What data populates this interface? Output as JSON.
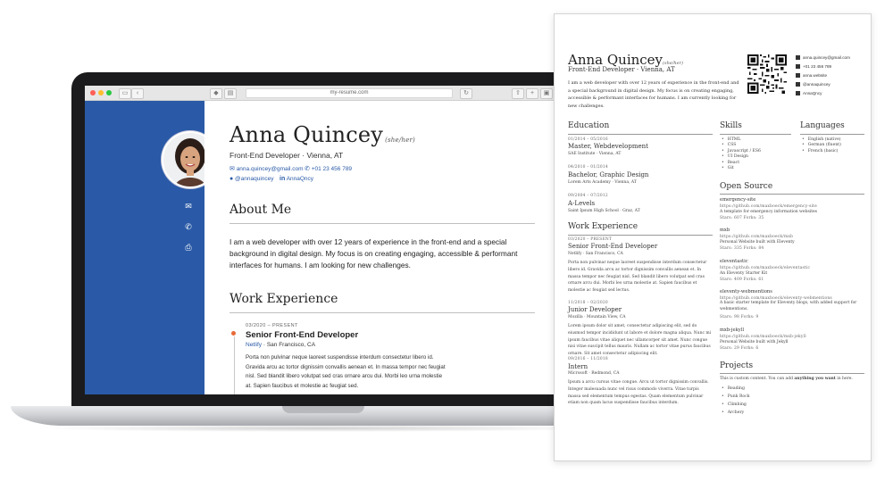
{
  "colors": {
    "sidebar_blue": "#2a5aa7",
    "accent_orange": "#e86a3a"
  },
  "browser": {
    "url": "my-resume.com"
  },
  "site": {
    "name": "Anna Quincey",
    "pronouns": "(she/her)",
    "role": "Front-End Developer · Vienna, AT",
    "email": "anna.quincey@gmail.com",
    "phone": "+01 23 456 789",
    "github": "@annaquincey",
    "linkedin": "AnnaQncy",
    "about_heading": "About Me",
    "about_text": "I am a web developer with over 12 years of experience in the front-end and a special background in digital design. My focus is on creating engaging, accessible & performant interfaces for humans. I am looking for new challenges.",
    "work_heading": "Work Experience",
    "job_date": "03/2020 – PRESENT",
    "job_title": "Senior Front-End Developer",
    "job_company": "Netlify",
    "job_location": "· San Francisco, CA",
    "job_desc": "Porta non pulvinar neque laoreet suspendisse interdum consectetur libero id. Gravida arcu ac tortor dignissim convallis aenean et. In massa tempor nec feugiat nisl. Sed blandit libero volutpat sed cras ornare arcu dui. Morbi leo urna molestie at. Sapien faucibus et molestie ac feugiat sed."
  },
  "paper": {
    "name": "Anna Quincey",
    "pronouns": "(she/her)",
    "role": "Front-End Developer · Vienna, AT",
    "intro": "I am a web developer with over 12 years of experience in the front-end and a special background in digital design. My focus is on creating engaging, accessible & performant interfaces for humans. I am currently looking for new challenges.",
    "contacts": [
      "anna.quincey@gmail.com",
      "+01 23 456 789",
      "anna.website",
      "@annaquincey",
      "AnnaQncy"
    ],
    "education_heading": "Education",
    "education": [
      {
        "date": "01/2014 – 05/2016",
        "title": "Master, Webdevelopment",
        "place": "SAE Institute · Vienna, AT"
      },
      {
        "date": "04/2010 – 01/2014",
        "title": "Bachelor, Graphic Design",
        "place": "Lorem Arts Academy · Vienna, AT"
      },
      {
        "date": "09/2004 – 07/2012",
        "title": "A-Levels",
        "place": "Saint Ipsum High School · Graz, AT"
      }
    ],
    "work_heading": "Work Experience",
    "work": [
      {
        "date": "03/2020 – PRESENT",
        "title": "Senior Front-End Developer",
        "place": "Netlify · San Francisco, CA",
        "desc": "Porta non pulvinar neque laoreet suspendisse interdum consectetur libero id. Gravida arcu ac tortor dignissim convallis aenean et. In massa tempor nec feugiat nisl. Sed blandit libero volutpat sed cras ornare arcu dui. Morbi leo urna molestie at. Sapien faucibus et molestie ac feugiat sed lectus."
      },
      {
        "date": "11/2018 – 02/2020",
        "title": "Junior Developer",
        "place": "Mozilla · Mountain View, CA",
        "desc": "Lorem ipsum dolor sit amet, consectetur adipiscing elit, sed do eiusmod tempor incididunt ut labore et dolore magna aliqua. Nunc mi ipsum faucibus vitae aliquet nec ullamcorper sit amet. Nunc congue nisi vitae suscipit tellus mauris. Nullam ac tortor vitae purus faucibus ornare. Sit amet consectetur adipiscing elit."
      },
      {
        "date": "09/2016 – 11/2018",
        "title": "Intern",
        "place": "Microsoft · Redmond, CA",
        "desc": "Ipsum a arcu cursus vitae congue. Arcu ut tortor dignissim convallis. Integer malesuada nunc vel risus commodo viverra. Vitae turpis massa sed elementum tempus egestas. Quam elementum pulvinar etiam non quam lacus suspendisse faucibus interdum."
      }
    ],
    "skills_heading": "Skills",
    "skills": [
      "HTML",
      "CSS",
      "Javascript / ES6",
      "UI Design",
      "React",
      "Git"
    ],
    "languages_heading": "Languages",
    "languages": [
      "English (native)",
      "German (fluent)",
      "French (basic)"
    ],
    "opensource_heading": "Open Source",
    "opensource": [
      {
        "name": "emergency-site",
        "url": "https://github.com/maxboeck/emergency-site",
        "desc": "A template for emergency information websites",
        "stats": "Stars: 607   Forks: 35"
      },
      {
        "name": "mxb",
        "url": "https://github.com/maxboeck/mxb",
        "desc": "Personal Website built with Eleventy",
        "stats": "Stars: 335   Forks: 84"
      },
      {
        "name": "eleventastic",
        "url": "https://github.com/maxboeck/eleventastic",
        "desc": "An Eleventy Starter Kit",
        "stats": "Stars: 409   Forks: 61"
      },
      {
        "name": "eleventy-webmentions",
        "url": "https://github.com/maxboeck/eleventy-webmentions",
        "desc": "A basic starter template for Eleventy blogs, with added support for webmentions.",
        "stats": "Stars: 98   Forks: 9"
      },
      {
        "name": "mxb-jekyll",
        "url": "https://github.com/maxboeck/mxb-jekyll",
        "desc": "Personal Website built with Jekyll",
        "stats": "Stars: 29   Forks: 6"
      }
    ],
    "projects_heading": "Projects",
    "projects_intro_a": "This is custom content. You can add ",
    "projects_intro_b": "anything you want",
    "projects_intro_c": " in here.",
    "projects": [
      "Reading",
      "Punk Rock",
      "Climbing",
      "Archery"
    ]
  }
}
